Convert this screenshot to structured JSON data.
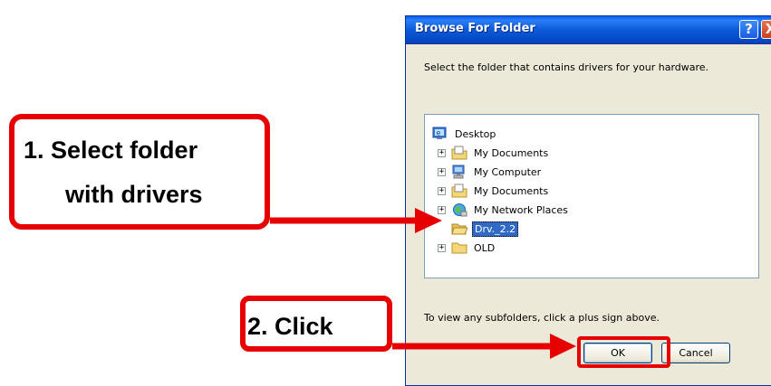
{
  "dialog": {
    "title": "Browse For Folder",
    "help_glyph": "?",
    "close_glyph": "X",
    "instruction": "Select the folder that contains drivers for your hardware.",
    "hint": "To view any subfolders, click a plus sign above.",
    "ok_label": "OK",
    "cancel_label": "Cancel"
  },
  "tree": {
    "items": [
      {
        "label": "Desktop",
        "icon": "desktop-icon",
        "expander": ""
      },
      {
        "label": "My Documents",
        "icon": "documents-folder-icon",
        "expander": "+"
      },
      {
        "label": "My Computer",
        "icon": "computer-icon",
        "expander": "+"
      },
      {
        "label": "My Documents",
        "icon": "documents-folder-icon",
        "expander": "+"
      },
      {
        "label": "My Network Places",
        "icon": "network-places-icon",
        "expander": "+"
      },
      {
        "label": "Drv._2.2",
        "icon": "open-folder-icon",
        "expander": "",
        "selected": true
      },
      {
        "label": "OLD",
        "icon": "folder-icon",
        "expander": "+"
      }
    ]
  },
  "annotations": {
    "step1_line1": "1. Select folder",
    "step1_line2": "with drivers",
    "step2": "2. Click",
    "color": "#e60000"
  }
}
